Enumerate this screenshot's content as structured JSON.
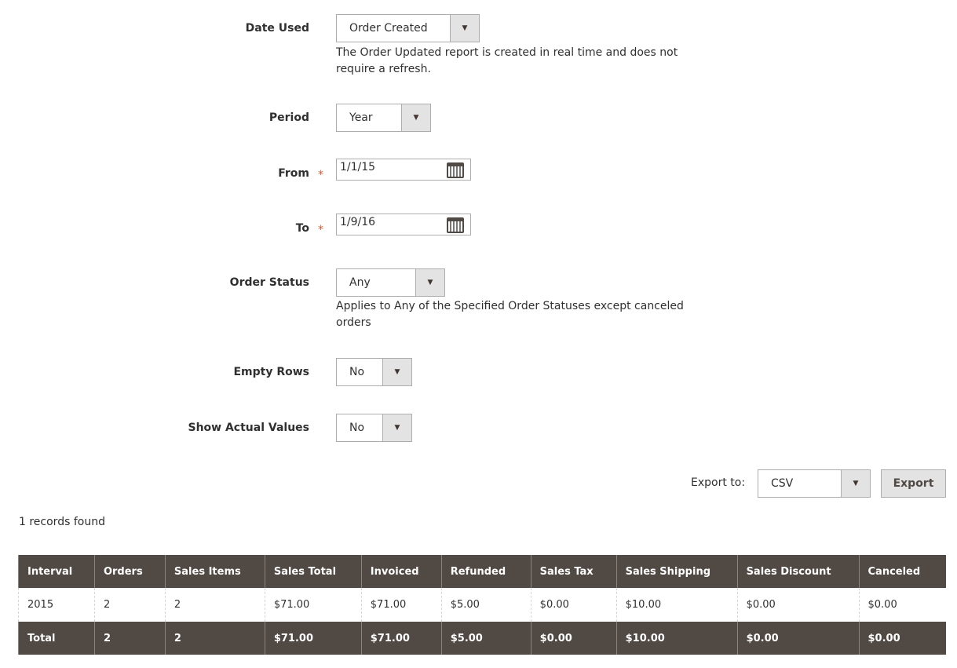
{
  "form": {
    "date_used": {
      "label": "Date Used",
      "value": "Order Created",
      "note": "The Order Updated report is created in real time and does not require a refresh."
    },
    "period": {
      "label": "Period",
      "value": "Year"
    },
    "from": {
      "label": "From",
      "value": "1/1/15",
      "required": "*"
    },
    "to": {
      "label": "To",
      "value": "1/9/16",
      "required": "*"
    },
    "order_status": {
      "label": "Order Status",
      "value": "Any",
      "note": "Applies to Any of the Specified Order Statuses except canceled orders"
    },
    "empty_rows": {
      "label": "Empty Rows",
      "value": "No"
    },
    "show_actual": {
      "label": "Show Actual Values",
      "value": "No"
    }
  },
  "export": {
    "label": "Export to:",
    "value": "CSV",
    "button": "Export"
  },
  "records": "1 records found",
  "table": {
    "headers": [
      "Interval",
      "Orders",
      "Sales Items",
      "Sales Total",
      "Invoiced",
      "Refunded",
      "Sales Tax",
      "Sales Shipping",
      "Sales Discount",
      "Canceled"
    ],
    "rows": [
      [
        "2015",
        "2",
        "2",
        "$71.00",
        "$71.00",
        "$5.00",
        "$0.00",
        "$10.00",
        "$0.00",
        "$0.00"
      ]
    ],
    "totals": [
      "Total",
      "2",
      "2",
      "$71.00",
      "$71.00",
      "$5.00",
      "$0.00",
      "$10.00",
      "$0.00",
      "$0.00"
    ]
  },
  "colors": {
    "header_bg": "#514943",
    "required": "#e0562e"
  }
}
